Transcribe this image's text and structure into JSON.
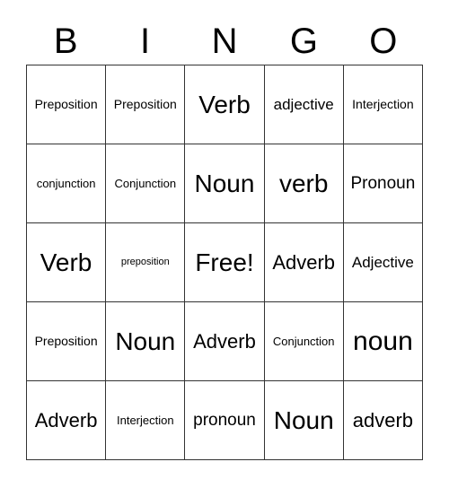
{
  "card": {
    "title_letters": [
      "B",
      "I",
      "N",
      "G",
      "O"
    ],
    "free_space_label": "Free!",
    "rows": [
      [
        {
          "label": "Preposition",
          "size": "sz-m"
        },
        {
          "label": "Preposition",
          "size": "sz-m"
        },
        {
          "label": "Verb",
          "size": "sz-xxl"
        },
        {
          "label": "adjective",
          "size": "sz-ml"
        },
        {
          "label": "Interjection",
          "size": "sz-m"
        }
      ],
      [
        {
          "label": "conjunction",
          "size": "sz-s"
        },
        {
          "label": "Conjunction",
          "size": "sz-s"
        },
        {
          "label": "Noun",
          "size": "sz-xxl"
        },
        {
          "label": "verb",
          "size": "sz-xxl"
        },
        {
          "label": "Pronoun",
          "size": "sz-l"
        }
      ],
      [
        {
          "label": "Verb",
          "size": "sz-xxl"
        },
        {
          "label": "preposition",
          "size": "sz-xs"
        },
        {
          "label": "Free!",
          "size": "sz-xxl"
        },
        {
          "label": "Adverb",
          "size": "sz-xl"
        },
        {
          "label": "Adjective",
          "size": "sz-ml"
        }
      ],
      [
        {
          "label": "Preposition",
          "size": "sz-m"
        },
        {
          "label": "Noun",
          "size": "sz-xxl"
        },
        {
          "label": "Adverb",
          "size": "sz-xl"
        },
        {
          "label": "Conjunction",
          "size": "sz-s"
        },
        {
          "label": "noun",
          "size": "sz-huge"
        }
      ],
      [
        {
          "label": "Adverb",
          "size": "sz-xl"
        },
        {
          "label": "Interjection",
          "size": "sz-s"
        },
        {
          "label": "pronoun",
          "size": "sz-l"
        },
        {
          "label": "Noun",
          "size": "sz-xxl"
        },
        {
          "label": "adverb",
          "size": "sz-xl"
        }
      ]
    ],
    "colors": {
      "text": "#000000",
      "border": "#333333",
      "background": "#ffffff"
    }
  }
}
